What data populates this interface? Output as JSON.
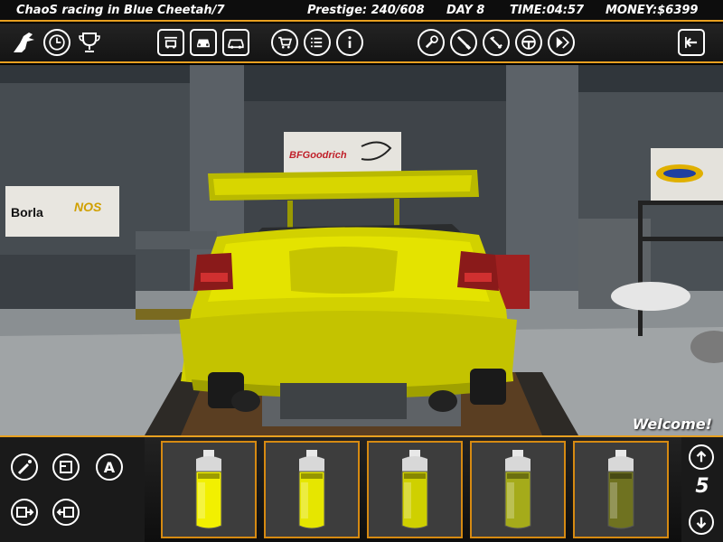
{
  "status": {
    "driver": "ChaoS racing in Blue Cheetah/7",
    "prestige": "Prestige: 240/608",
    "day": "DAY 8",
    "time": "TIME:04:57",
    "money": "MONEY:$6399"
  },
  "toolbar": {
    "icons": [
      "cheetah-logo-icon",
      "clock-icon",
      "trophy-icon",
      "garage-icon",
      "car-front-icon",
      "car-swap-icon",
      "shop-cart-icon",
      "list-icon",
      "info-icon",
      "wrench-icon",
      "screwdriver-icon",
      "tune-icon",
      "steering-wheel-icon",
      "play-forward-icon",
      "exit-icon"
    ]
  },
  "scene": {
    "sponsor_banners": [
      "BFGoodrich",
      "Borla",
      "NOS"
    ],
    "welcome": "Welcome!"
  },
  "bottom": {
    "left_icons": [
      "spray-icon",
      "car-door-icon",
      "decal-a-icon",
      "import-icon",
      "export-icon"
    ],
    "decal_letter": "A",
    "paint_colors": [
      "#f2f000",
      "#e6e600",
      "#cfd000",
      "#a5ab1a",
      "#6f7220"
    ],
    "page": "5"
  },
  "colors": {
    "accent": "#e8a020",
    "car_body": "#d8d600"
  }
}
